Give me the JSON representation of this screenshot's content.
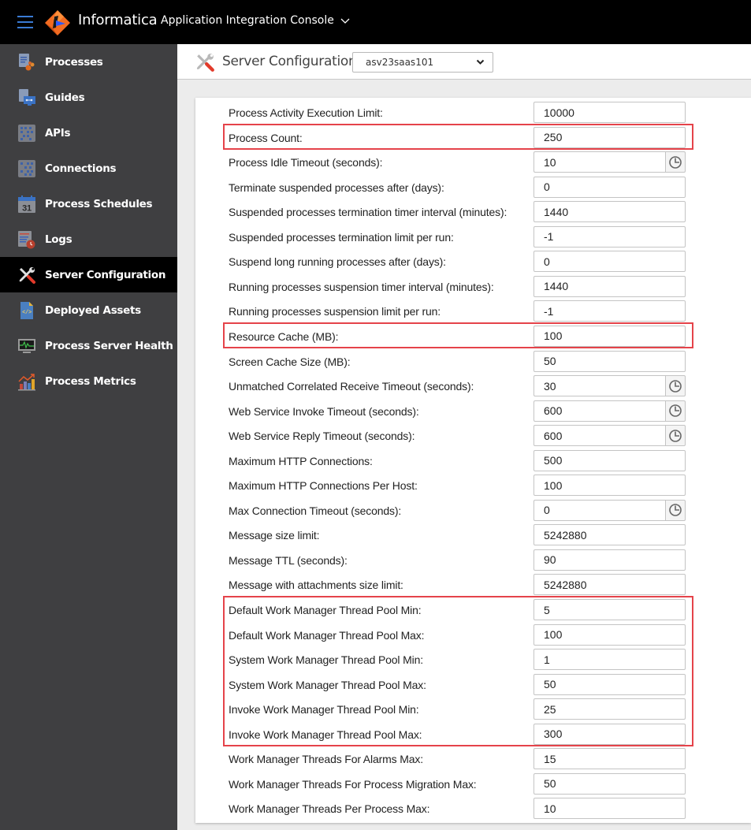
{
  "topbar": {
    "brand": "Informatica",
    "app_title": "Application Integration Console",
    "menu_icon": "hamburger-menu-icon",
    "logo_icon": "informatica-logo-icon",
    "app_switcher_icon": "chevron-down-icon"
  },
  "sidebar": {
    "items": [
      {
        "label": "Processes",
        "icon": "processes-icon",
        "active": false
      },
      {
        "label": "Guides",
        "icon": "guides-icon",
        "active": false
      },
      {
        "label": "APIs",
        "icon": "apis-icon",
        "active": false
      },
      {
        "label": "Connections",
        "icon": "connections-icon",
        "active": false
      },
      {
        "label": "Process Schedules",
        "icon": "calendar-icon",
        "active": false
      },
      {
        "label": "Logs",
        "icon": "logs-icon",
        "active": false
      },
      {
        "label": "Server Configuration",
        "icon": "wrench-screwdriver-icon",
        "active": true
      },
      {
        "label": "Deployed Assets",
        "icon": "code-file-icon",
        "active": false
      },
      {
        "label": "Process Server Health",
        "icon": "monitor-heartbeat-icon",
        "active": false
      },
      {
        "label": "Process Metrics",
        "icon": "bar-chart-icon",
        "active": false
      }
    ],
    "calendar_day": "31"
  },
  "header": {
    "title": "Server Configuration",
    "icon": "wrench-screwdriver-icon",
    "server_select": {
      "value": "asv23saas101",
      "icon": "chevron-down-icon"
    }
  },
  "settings": [
    {
      "label": "Process Activity Execution Limit:",
      "value": "10000",
      "timer": false
    },
    {
      "label": "Process Count:",
      "value": "250",
      "timer": false
    },
    {
      "label": "Process Idle Timeout (seconds):",
      "value": "10",
      "timer": true
    },
    {
      "label": "Terminate suspended processes after (days):",
      "value": "0",
      "timer": false
    },
    {
      "label": "Suspended processes termination timer interval (minutes):",
      "value": "1440",
      "timer": false
    },
    {
      "label": "Suspended processes termination limit per run:",
      "value": "-1",
      "timer": false
    },
    {
      "label": "Suspend long running processes after (days):",
      "value": "0",
      "timer": false
    },
    {
      "label": "Running processes suspension timer interval (minutes):",
      "value": "1440",
      "timer": false
    },
    {
      "label": "Running processes suspension limit per run:",
      "value": "-1",
      "timer": false
    },
    {
      "label": "Resource Cache (MB):",
      "value": "100",
      "timer": false
    },
    {
      "label": "Screen Cache Size (MB):",
      "value": "50",
      "timer": false
    },
    {
      "label": "Unmatched Correlated Receive Timeout (seconds):",
      "value": "30",
      "timer": true
    },
    {
      "label": "Web Service Invoke Timeout (seconds):",
      "value": "600",
      "timer": true
    },
    {
      "label": "Web Service Reply Timeout (seconds):",
      "value": "600",
      "timer": true
    },
    {
      "label": "Maximum HTTP Connections:",
      "value": "500",
      "timer": false
    },
    {
      "label": "Maximum HTTP Connections Per Host:",
      "value": "100",
      "timer": false
    },
    {
      "label": "Max Connection Timeout (seconds):",
      "value": "0",
      "timer": true
    },
    {
      "label": "Message size limit:",
      "value": "5242880",
      "timer": false
    },
    {
      "label": "Message TTL (seconds):",
      "value": "90",
      "timer": false
    },
    {
      "label": "Message with attachments size limit:",
      "value": "5242880",
      "timer": false
    },
    {
      "label": "Default Work Manager Thread Pool Min:",
      "value": "5",
      "timer": false
    },
    {
      "label": "Default Work Manager Thread Pool Max:",
      "value": "100",
      "timer": false
    },
    {
      "label": "System Work Manager Thread Pool Min:",
      "value": "1",
      "timer": false
    },
    {
      "label": "System Work Manager Thread Pool Max:",
      "value": "50",
      "timer": false
    },
    {
      "label": "Invoke Work Manager Thread Pool Min:",
      "value": "25",
      "timer": false
    },
    {
      "label": "Invoke Work Manager Thread Pool Max:",
      "value": "300",
      "timer": false
    },
    {
      "label": "Work Manager Threads For Alarms Max:",
      "value": "15",
      "timer": false
    },
    {
      "label": "Work Manager Threads For Process Migration Max:",
      "value": "50",
      "timer": false
    },
    {
      "label": "Work Manager Threads Per Process Max:",
      "value": "10",
      "timer": false
    }
  ],
  "highlights": [
    {
      "name": "process-count-highlight",
      "from_row": 1,
      "to_row": 1
    },
    {
      "name": "resource-cache-highlight",
      "from_row": 9,
      "to_row": 9
    },
    {
      "name": "thread-pool-highlight",
      "from_row": 20,
      "to_row": 25
    }
  ],
  "colors": {
    "highlight": "#e5434a",
    "topbar_bg": "#000000",
    "sidebar_bg": "#3f3f41",
    "sidebar_active_bg": "#000000",
    "brand_orange": "#f26b21"
  }
}
